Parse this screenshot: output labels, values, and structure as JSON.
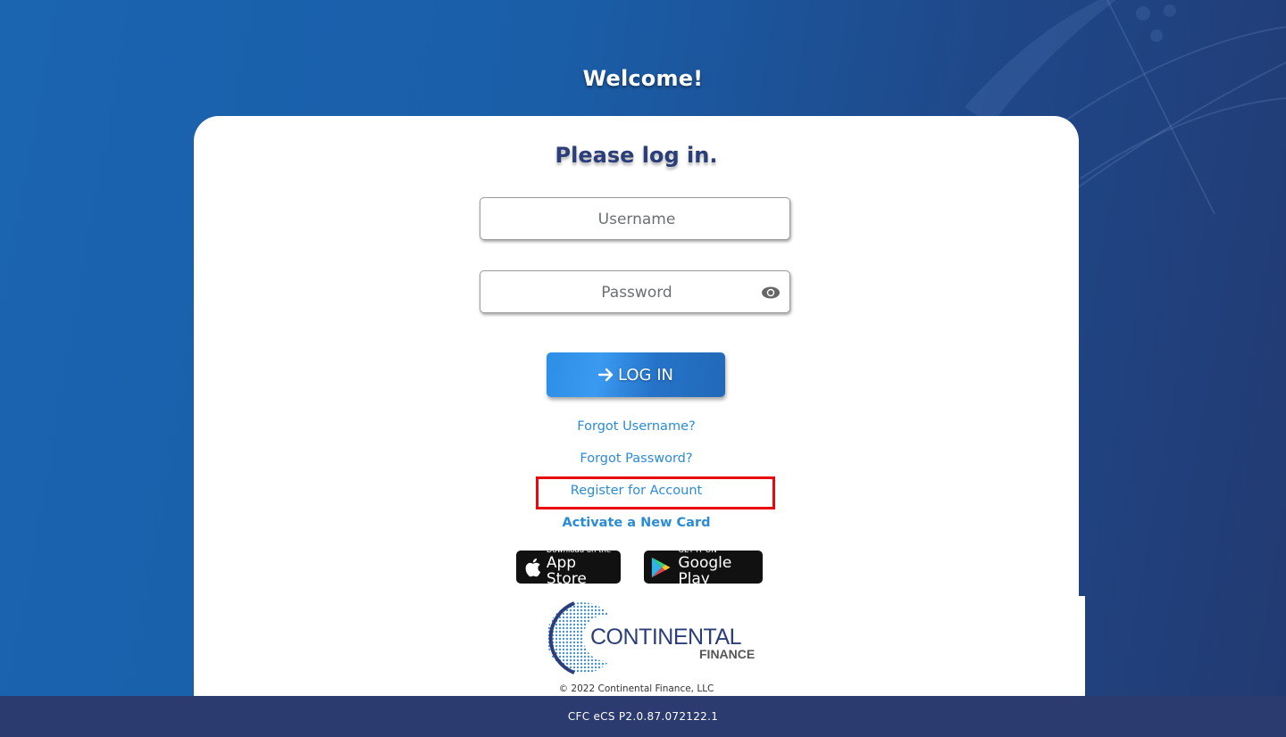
{
  "page": {
    "welcome": "Welcome!",
    "title": "Please log in."
  },
  "form": {
    "username_placeholder": "Username",
    "username_value": "",
    "password_placeholder": "Password",
    "password_value": "",
    "password_toggle_icon": "eye-icon",
    "login_icon": "arrow-right-icon",
    "login_label": "LOG IN"
  },
  "links": {
    "forgot_username": "Forgot Username?",
    "forgot_password": "Forgot Password?",
    "register": "Register for Account",
    "activate_card": "Activate a New Card"
  },
  "stores": {
    "apple_small": "Download on the",
    "apple_big": "App Store",
    "google_small": "GET IT ON",
    "google_big": "Google Play"
  },
  "brand": {
    "name": "CONTINENTAL",
    "sub": "FINANCE",
    "copyright": "© 2022 Continental Finance, LLC"
  },
  "footer": {
    "version": "CFC eCS P2.0.87.072122.1"
  },
  "colors": {
    "brand_navy": "#2c3e7a",
    "link_blue": "#2a8bd8",
    "button_blue": "#2d8ee6",
    "highlight_red": "#e8080e",
    "footer_bg": "#2b3a6f"
  }
}
